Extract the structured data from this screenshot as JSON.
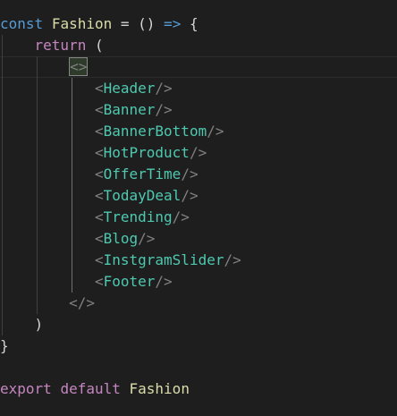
{
  "code": {
    "line1": {
      "keyword": "const",
      "name": "Fashion",
      "assign": " = ",
      "parens": "()",
      "arrow": " => ",
      "brace": "{"
    },
    "line2": {
      "keyword": "return",
      "paren": "("
    },
    "fragment_open": "<>",
    "components": [
      "Header",
      "Banner",
      "BannerBottom",
      "HotProduct",
      "OfferTime",
      "TodayDeal",
      "Trending",
      "Blog",
      "InstgramSlider",
      "Footer"
    ],
    "self_close_open": "<",
    "self_close_end": "/>",
    "fragment_close": "</>",
    "close_paren": ")",
    "close_brace": "}",
    "export_line": {
      "keyword1": "export",
      "keyword2": "default",
      "name": "Fashion"
    }
  },
  "colors": {
    "background": "#1e1e1e",
    "storage_keyword": "#569cd6",
    "control_keyword": "#c586c0",
    "function_name": "#dcdcaa",
    "component": "#4ec9b0",
    "tag_bracket": "#808080",
    "punctuation": "#d4d4d4"
  }
}
